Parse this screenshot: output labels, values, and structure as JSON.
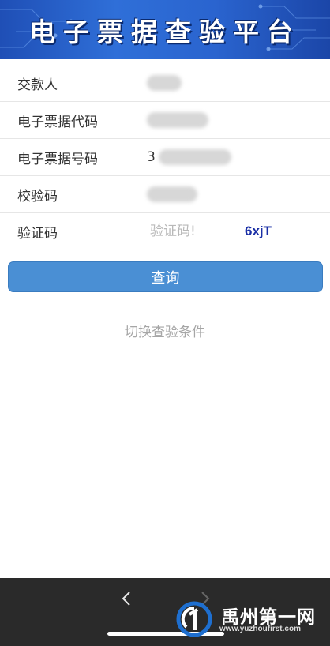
{
  "header": {
    "title": "电子票据查验平台"
  },
  "form": {
    "fields": [
      {
        "label": "交款人",
        "value_visible": ""
      },
      {
        "label": "电子票据代码",
        "value_visible": ""
      },
      {
        "label": "电子票据号码",
        "value_visible": "3"
      },
      {
        "label": "校验码",
        "value_visible": ""
      }
    ],
    "captcha": {
      "label": "验证码",
      "placeholder": "验证码!",
      "code": "6xjT",
      "code_color": "#1a2fa6"
    }
  },
  "actions": {
    "query_label": "查询",
    "switch_label": "切换查验条件"
  },
  "bottom_bar": {
    "back_icon": "chevron-left-icon",
    "forward_icon": "chevron-right-icon"
  },
  "watermark": {
    "name": "禹州第一网",
    "url": "www.yuzhoufirst.com"
  },
  "colors": {
    "header_blue": "#2f6fd8",
    "button_blue": "#4a8fd4",
    "bottom_bar": "#2a2a2a"
  }
}
